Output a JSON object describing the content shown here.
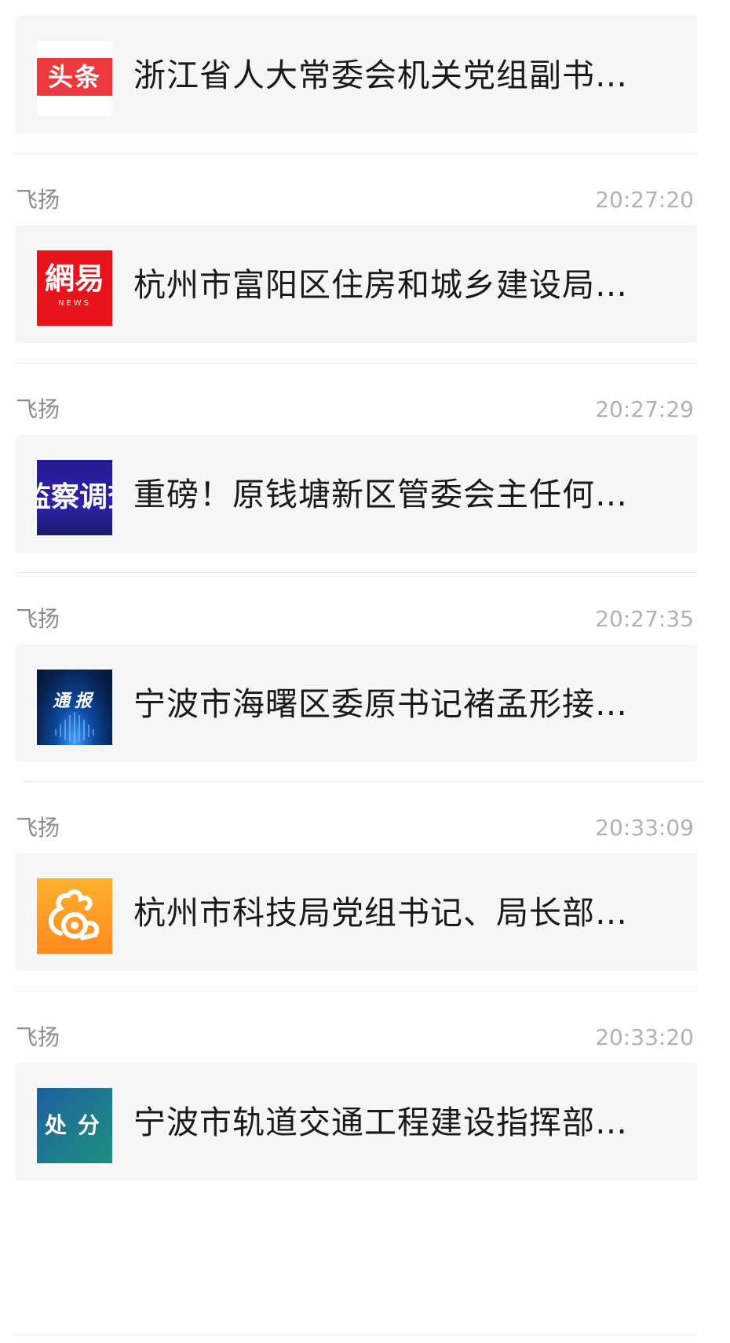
{
  "messages": [
    {
      "card": {
        "thumb": "toutiao-logo",
        "thumb_text": "头条",
        "title": "浙江省人大常委会机关党组副书…"
      }
    },
    {
      "sender": "飞扬",
      "time": "20:27:20",
      "card": {
        "thumb": "netease-news-logo",
        "thumb_text": "網易",
        "thumb_sub": "NEWS",
        "title": "杭州市富阳区住房和城乡建设局…"
      }
    },
    {
      "sender": "飞扬",
      "time": "20:27:29",
      "card": {
        "thumb": "jiancha-diaocha-image",
        "thumb_text": "监察调查",
        "title": "重磅！原钱塘新区管委会主任何…"
      }
    },
    {
      "sender": "飞扬",
      "time": "20:27:35",
      "card": {
        "thumb": "tongbao-image",
        "thumb_text": "通报",
        "title": "宁波市海曙区委原书记褚孟形接…"
      }
    },
    {
      "sender": "飞扬",
      "time": "20:33:09",
      "card": {
        "thumb": "uc-browser-logo",
        "title": "杭州市科技局党组书记、局长部…"
      }
    },
    {
      "sender": "飞扬",
      "time": "20:33:20",
      "card": {
        "thumb": "chufen-image",
        "thumb_text": "处分",
        "title": "宁波市轨道交通工程建设指挥部…"
      }
    }
  ],
  "colors": {
    "card_background": "#f6f6f8",
    "title_text": "#1a1a1a",
    "sender_text": "#8c8c8c",
    "time_text": "#b2b2b2",
    "toutiao_red": "#ee3a3f",
    "netease_red": "#e8131b",
    "uc_orange": "#ff9a22"
  }
}
